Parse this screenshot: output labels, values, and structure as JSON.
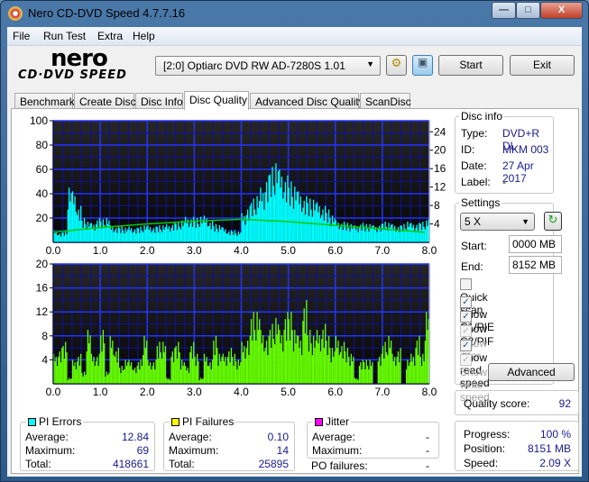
{
  "window": {
    "title": "Nero CD-DVD Speed 4.7.7.16",
    "minimize": "—",
    "maximize": "□",
    "close": "X"
  },
  "menu": [
    "File",
    "Run Test",
    "Extra",
    "Help"
  ],
  "logo": {
    "line1": "nero",
    "line2": "CD·DVD SPEED"
  },
  "toolbar": {
    "drive": "[2:0]  Optiarc DVD RW AD-7280S 1.01",
    "start": "Start",
    "exit": "Exit"
  },
  "tabs": [
    {
      "label": "Benchmark"
    },
    {
      "label": "Create Disc"
    },
    {
      "label": "Disc Info"
    },
    {
      "label": "Disc Quality",
      "active": true
    },
    {
      "label": "Advanced Disc Quality"
    },
    {
      "label": "ScanDisc"
    }
  ],
  "disc_info": {
    "title": "Disc info",
    "type_label": "Type:",
    "type": "DVD+R DL",
    "id_label": "ID:",
    "id": "MKM 003",
    "date_label": "Date:",
    "date": "27 Apr 2017",
    "label_label": "Label:",
    "label": "-"
  },
  "settings": {
    "title": "Settings",
    "speed": "5 X",
    "start_label": "Start:",
    "start": "0000 MB",
    "end_label": "End:",
    "end": "8152 MB",
    "checks": [
      {
        "label": "Quick scan",
        "checked": false,
        "enabled": true
      },
      {
        "label": "Show C1/PIE",
        "checked": true,
        "enabled": true
      },
      {
        "label": "Show C2/PIF",
        "checked": true,
        "enabled": true
      },
      {
        "label": "Show jitter",
        "checked": true,
        "enabled": false
      },
      {
        "label": "Show read speed",
        "checked": true,
        "enabled": true
      },
      {
        "label": "Show write speed",
        "checked": true,
        "enabled": false
      }
    ],
    "advanced": "Advanced"
  },
  "quality": {
    "label": "Quality score:",
    "value": "92"
  },
  "progress": {
    "progress_label": "Progress:",
    "progress": "100 %",
    "position_label": "Position:",
    "position": "8151 MB",
    "speed_label": "Speed:",
    "speed": "2.09 X"
  },
  "stats": {
    "pi_errors": {
      "title": "PI Errors",
      "color": "#00ffff",
      "avg_label": "Average:",
      "avg": "12.84",
      "max_label": "Maximum:",
      "max": "69",
      "total_label": "Total:",
      "total": "418661"
    },
    "pi_failures": {
      "title": "PI Failures",
      "color": "#ffff00",
      "avg_label": "Average:",
      "avg": "0.10",
      "max_label": "Maximum:",
      "max": "14",
      "total_label": "Total:",
      "total": "25895"
    },
    "jitter": {
      "title": "Jitter",
      "color": "#ff00ff",
      "avg_label": "Average:",
      "avg": "-",
      "max_label": "Maximum:",
      "max": "-"
    },
    "po_label": "PO failures:",
    "po": "-"
  },
  "chart_data": [
    {
      "type": "bar",
      "xlim": [
        0,
        8
      ],
      "ylim": [
        0,
        100
      ],
      "y2lim": [
        0,
        26.4
      ],
      "grid": true,
      "xticks": [
        "0.0",
        "1.0",
        "2.0",
        "3.0",
        "4.0",
        "5.0",
        "6.0",
        "7.0",
        "8.0"
      ],
      "yticks": [
        "20",
        "40",
        "60",
        "80",
        "100"
      ],
      "y2ticks": [
        "4",
        "8",
        "12",
        "16",
        "20",
        "24"
      ],
      "bar_color": "#00ffff",
      "line_color": "#00cc00",
      "x_step": 0.1,
      "values": [
        10,
        8,
        9,
        45,
        42,
        30,
        20,
        17,
        16,
        20,
        19,
        20,
        14,
        13,
        13,
        12,
        13,
        12,
        13,
        14,
        14,
        13,
        14,
        14,
        15,
        16,
        17,
        18,
        21,
        21,
        20,
        21,
        22,
        18,
        15,
        14,
        12,
        10,
        10,
        9,
        24,
        30,
        36,
        38,
        45,
        55,
        62,
        65,
        60,
        55,
        50,
        46,
        42,
        38,
        36,
        35,
        33,
        30,
        27,
        22,
        18,
        17,
        16,
        15,
        14,
        16,
        15,
        15,
        14,
        15,
        17,
        16,
        15,
        14,
        15,
        17,
        16,
        16,
        17,
        18,
        19
      ],
      "speed": [
        [
          0,
          2.2
        ],
        [
          1,
          3.2
        ],
        [
          2,
          4
        ],
        [
          3,
          4.6
        ],
        [
          4,
          5
        ],
        [
          5,
          4.5
        ],
        [
          6,
          3.7
        ],
        [
          7,
          2.9
        ],
        [
          7.9,
          2.2
        ]
      ]
    },
    {
      "type": "bar",
      "xlim": [
        0,
        8
      ],
      "ylim": [
        0,
        20
      ],
      "grid": true,
      "xticks": [
        "0.0",
        "1.0",
        "2.0",
        "3.0",
        "4.0",
        "5.0",
        "6.0",
        "7.0",
        "8.0"
      ],
      "yticks": [
        "4",
        "8",
        "12",
        "16",
        "20"
      ],
      "bar_color": "#66ff00",
      "x_step": 0.1,
      "values": [
        5,
        6,
        7,
        1,
        4,
        5,
        2,
        9,
        5,
        5,
        9,
        2,
        8,
        6,
        3,
        4,
        4,
        3,
        4,
        8,
        4,
        4,
        7,
        7,
        1,
        6,
        7,
        4,
        3,
        7,
        5,
        1,
        5,
        4,
        8,
        5,
        5,
        6,
        5,
        4,
        7,
        8,
        12,
        12,
        9,
        8,
        10,
        11,
        9,
        12,
        12,
        9,
        8,
        14,
        9,
        8,
        9,
        10,
        8,
        6,
        8,
        7,
        6,
        5,
        1,
        4,
        4,
        4,
        0,
        5,
        7,
        8,
        5,
        6,
        0,
        4,
        5,
        8,
        5,
        12,
        5
      ]
    }
  ]
}
